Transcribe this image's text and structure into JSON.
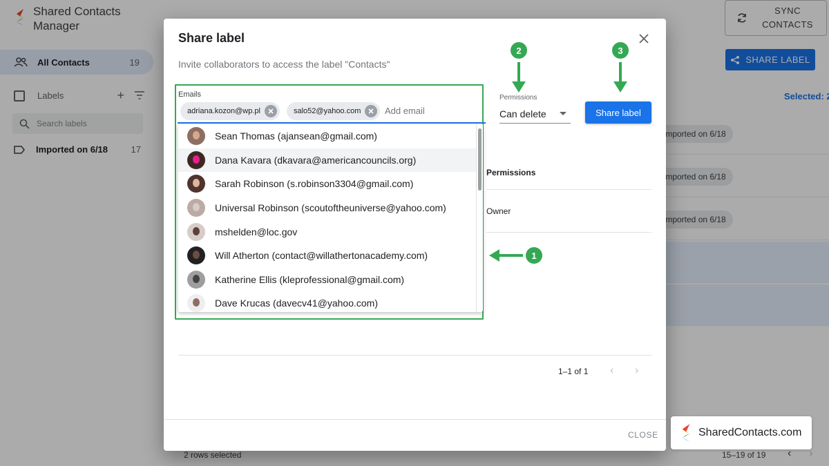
{
  "app": {
    "name": "Shared Contacts Manager",
    "nav_all_contacts": "All Contacts",
    "nav_all_contacts_count": "19",
    "labels_header": "Labels",
    "search_labels_placeholder": "Search labels",
    "label_item": "Imported on 6/18",
    "label_item_count": "17",
    "sync_button": "SYNC CONTACTS",
    "share_label_button": "SHARE LABEL",
    "selected_text": "Selected: 2",
    "row_chips": [
      "Imported on 6/18",
      "Imported on 6/18",
      "Imported on 6/18"
    ],
    "rows_selected": "2 rows selected",
    "pagination": "15–19 of 19"
  },
  "dialog": {
    "title": "Share label",
    "subtitle": "Invite collaborators to access the label \"Contacts\"",
    "emails_label": "Emails",
    "chips": [
      "adriana.kozon@wp.pl",
      "salo52@yahoo.com"
    ],
    "add_email_placeholder": "Add email",
    "permissions_label": "Permissions",
    "permission_value": "Can delete",
    "share_button": "Share label",
    "suggestions": [
      "Sean Thomas (ajansean@gmail.com)",
      "Dana Kavara (dkavara@americancouncils.org)",
      "Sarah Robinson (s.robinson3304@gmail.com)",
      "Universal Robinson (scoutoftheuniverse@yahoo.com)",
      "mshelden@loc.gov",
      "Will Atherton (contact@willathertonacademy.com)",
      "Katherine Ellis (kleprofessional@gmail.com)",
      "Dave Krucas (davecv41@yahoo.com)"
    ],
    "table_header_permissions": "Permissions",
    "table_owner": "Owner",
    "pager": "1–1 of 1",
    "close_button": "CLOSE"
  },
  "annotations": {
    "badge1": "1",
    "badge2": "2",
    "badge3": "3",
    "accent_color": "#34a853"
  },
  "watermark": "SharedContacts.com",
  "colors": {
    "primary": "#1a73e8",
    "annotation_green": "#34a853"
  }
}
